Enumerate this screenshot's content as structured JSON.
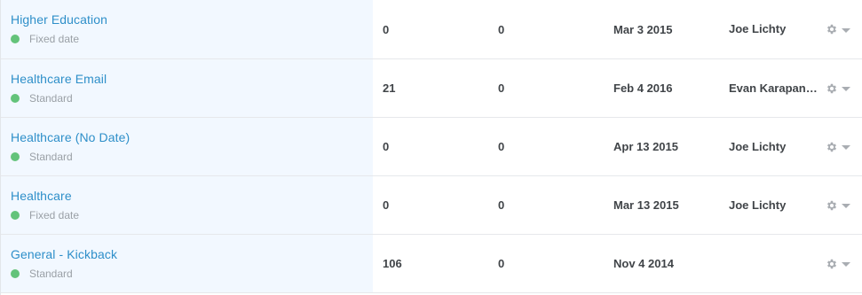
{
  "rows": [
    {
      "name": "Higher Education",
      "status": "Fixed date",
      "sent": "0",
      "opens": "0",
      "date": "Mar 3 2015",
      "owner": "Joe Lichty"
    },
    {
      "name": "Healthcare Email",
      "status": "Standard",
      "sent": "21",
      "opens": "0",
      "date": "Feb 4 2016",
      "owner": "Evan Karapanagiotis"
    },
    {
      "name": "Healthcare (No Date)",
      "status": "Standard",
      "sent": "0",
      "opens": "0",
      "date": "Apr 13 2015",
      "owner": "Joe Lichty"
    },
    {
      "name": "Healthcare",
      "status": "Fixed date",
      "sent": "0",
      "opens": "0",
      "date": "Mar 13 2015",
      "owner": "Joe Lichty"
    },
    {
      "name": "General - Kickback",
      "status": "Standard",
      "sent": "106",
      "opens": "0",
      "date": "Nov 4 2014",
      "owner": ""
    }
  ],
  "colors": {
    "link": "#2e8fc9",
    "status_dot": "#63c37a",
    "name_column_bg": "#f2f8ff"
  },
  "icons": {
    "status": "status-dot-icon",
    "settings": "gear-icon",
    "dropdown": "caret-down-icon"
  }
}
